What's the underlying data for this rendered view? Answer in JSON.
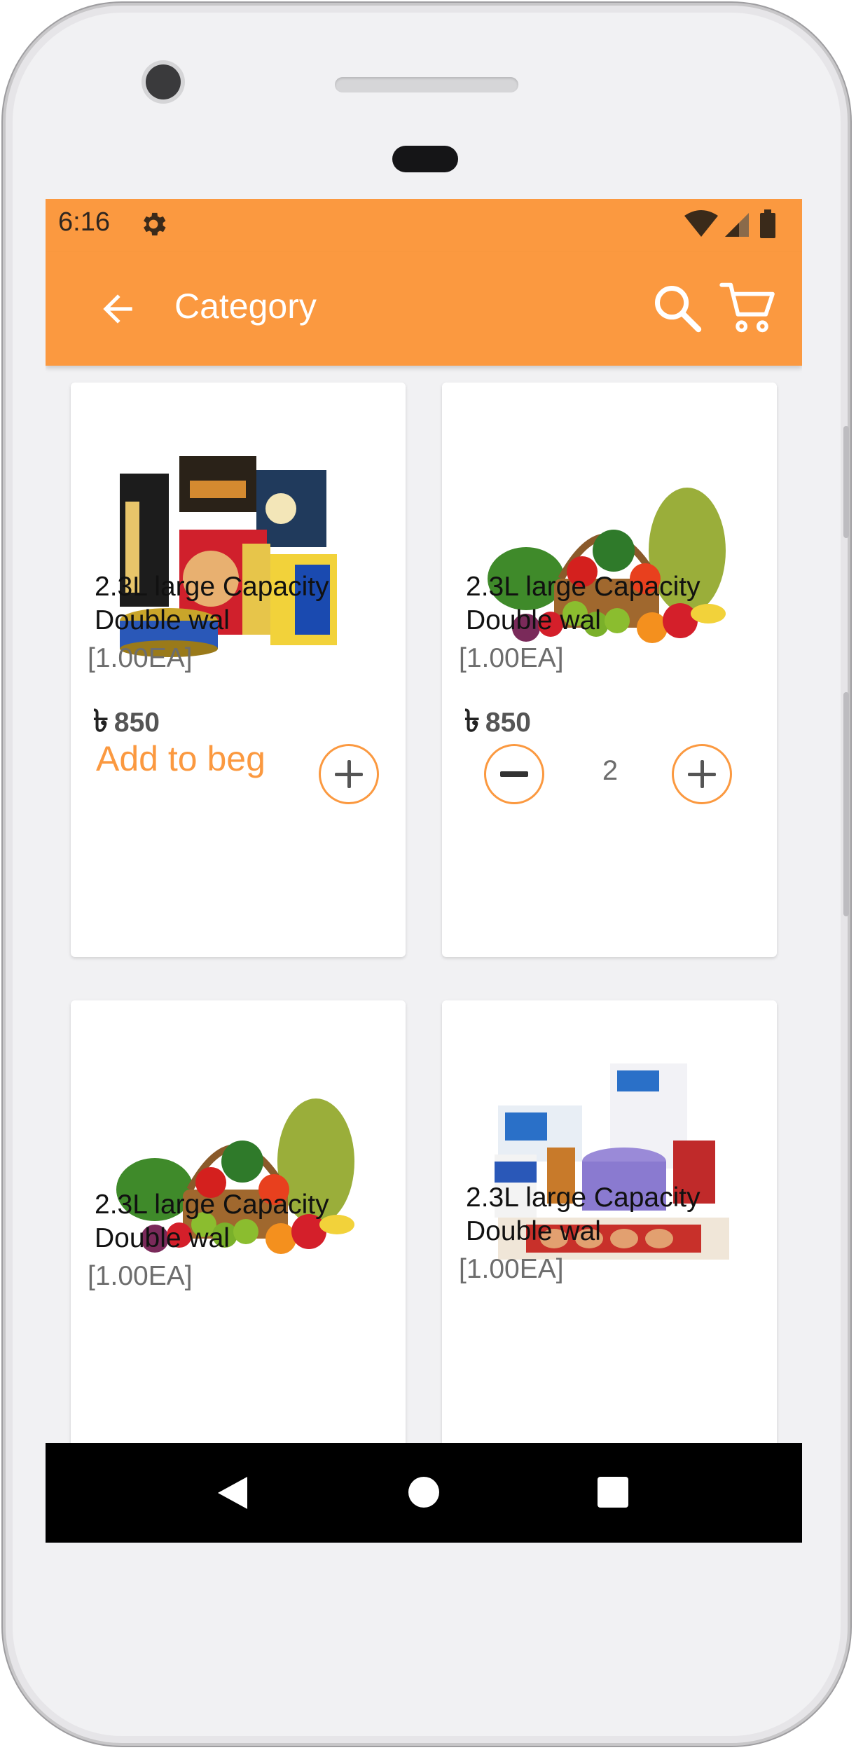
{
  "status_bar": {
    "time": "6:16"
  },
  "app_bar": {
    "title": "Category"
  },
  "currency_symbol": "৳",
  "products": [
    {
      "name": "2.3L large Capacity Double wal",
      "unit": "[1.00EA]",
      "price": "850",
      "add_label": "Add to beg",
      "image": "meat-products-image"
    },
    {
      "name": "2.3L large Capacity Double wal",
      "unit": "[1.00EA]",
      "price": "850",
      "quantity": "2",
      "image": "vegetable-basket-image"
    },
    {
      "name": "2.3L large Capacity Double wal",
      "unit": "[1.00EA]",
      "image": "vegetable-basket-image"
    },
    {
      "name": "2.3L large Capacity Double wal",
      "unit": "[1.00EA]",
      "image": "dairy-products-image"
    }
  ],
  "colors": {
    "accent": "#fb9940",
    "navbar": "#000000",
    "background": "#f1f1f3"
  }
}
